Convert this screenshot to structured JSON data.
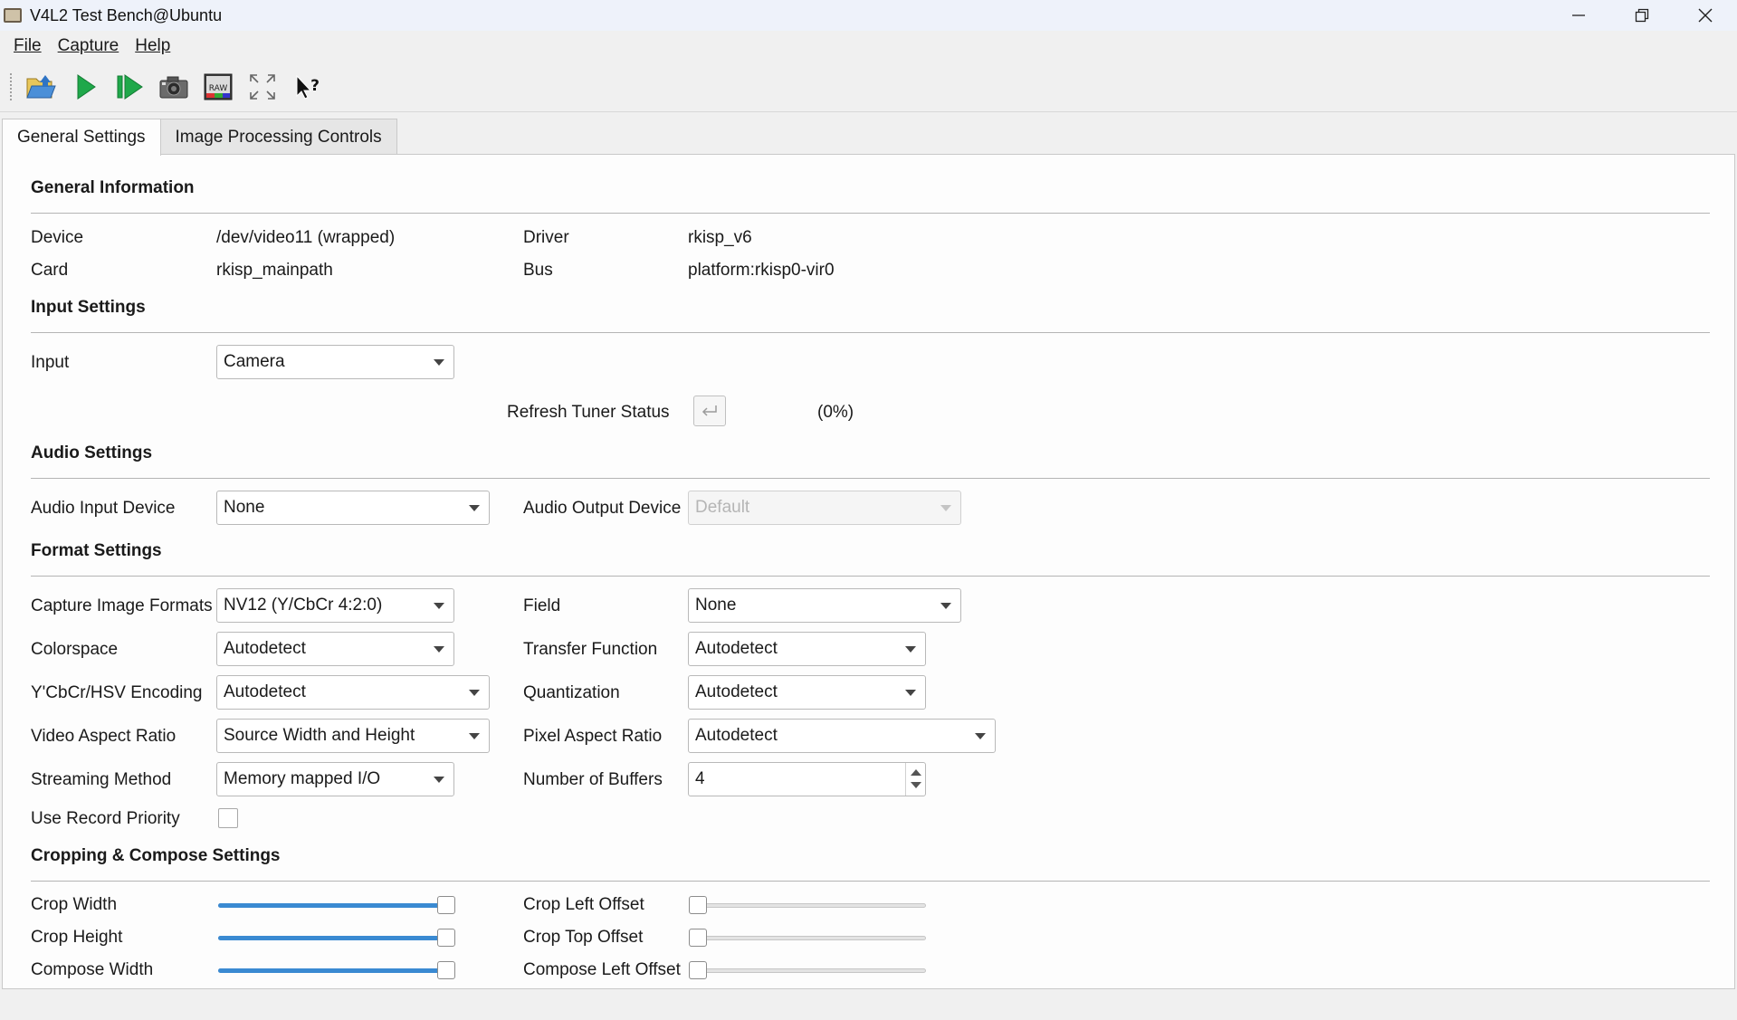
{
  "window": {
    "title": "V4L2 Test Bench@Ubuntu"
  },
  "menu": {
    "file": "File",
    "capture": "Capture",
    "help": "Help"
  },
  "toolbar": {
    "icons": [
      "open-device-icon",
      "start-capture-icon",
      "step-capture-icon",
      "snapshot-icon",
      "raw-icon",
      "fullscreen-icon",
      "whats-this-icon"
    ]
  },
  "tabs": {
    "general": "General Settings",
    "image_processing": "Image Processing Controls"
  },
  "general_info": {
    "title": "General Information",
    "device_label": "Device",
    "device_value": "/dev/video11 (wrapped)",
    "driver_label": "Driver",
    "driver_value": "rkisp_v6",
    "card_label": "Card",
    "card_value": "rkisp_mainpath",
    "bus_label": "Bus",
    "bus_value": "platform:rkisp0-vir0"
  },
  "input_settings": {
    "title": "Input Settings",
    "input_label": "Input",
    "input_value": "Camera",
    "refresh_label": "Refresh Tuner Status",
    "tuner_status": "(0%)"
  },
  "audio_settings": {
    "title": "Audio Settings",
    "input_device_label": "Audio Input Device",
    "input_device_value": "None",
    "output_device_label": "Audio Output Device",
    "output_device_value": "Default"
  },
  "format_settings": {
    "title": "Format Settings",
    "capture_formats_label": "Capture Image Formats",
    "capture_formats_value": "NV12 (Y/CbCr 4:2:0)",
    "field_label": "Field",
    "field_value": "None",
    "colorspace_label": "Colorspace",
    "colorspace_value": "Autodetect",
    "transfer_label": "Transfer Function",
    "transfer_value": "Autodetect",
    "encoding_label": "Y'CbCr/HSV Encoding",
    "encoding_value": "Autodetect",
    "quantization_label": "Quantization",
    "quantization_value": "Autodetect",
    "video_aspect_label": "Video Aspect Ratio",
    "video_aspect_value": "Source Width and Height",
    "pixel_aspect_label": "Pixel Aspect Ratio",
    "pixel_aspect_value": "Autodetect",
    "streaming_label": "Streaming Method",
    "streaming_value": "Memory mapped I/O",
    "buffers_label": "Number of Buffers",
    "buffers_value": "4",
    "record_priority_label": "Use Record Priority",
    "record_priority_checked": false
  },
  "cropping": {
    "title": "Cropping & Compose Settings",
    "crop_width_label": "Crop Width",
    "crop_width_level": 1.0,
    "crop_height_label": "Crop Height",
    "crop_height_level": 1.0,
    "compose_width_label": "Compose Width",
    "compose_width_level": 1.0,
    "crop_left_label": "Crop Left Offset",
    "crop_left_level": 0.0,
    "crop_top_label": "Crop Top Offset",
    "crop_top_level": 0.0,
    "compose_left_label": "Compose Left Offset",
    "compose_left_level": 0.0
  },
  "colors": {
    "accent": "#3a8ad2",
    "play_green": "#1fa84a"
  }
}
